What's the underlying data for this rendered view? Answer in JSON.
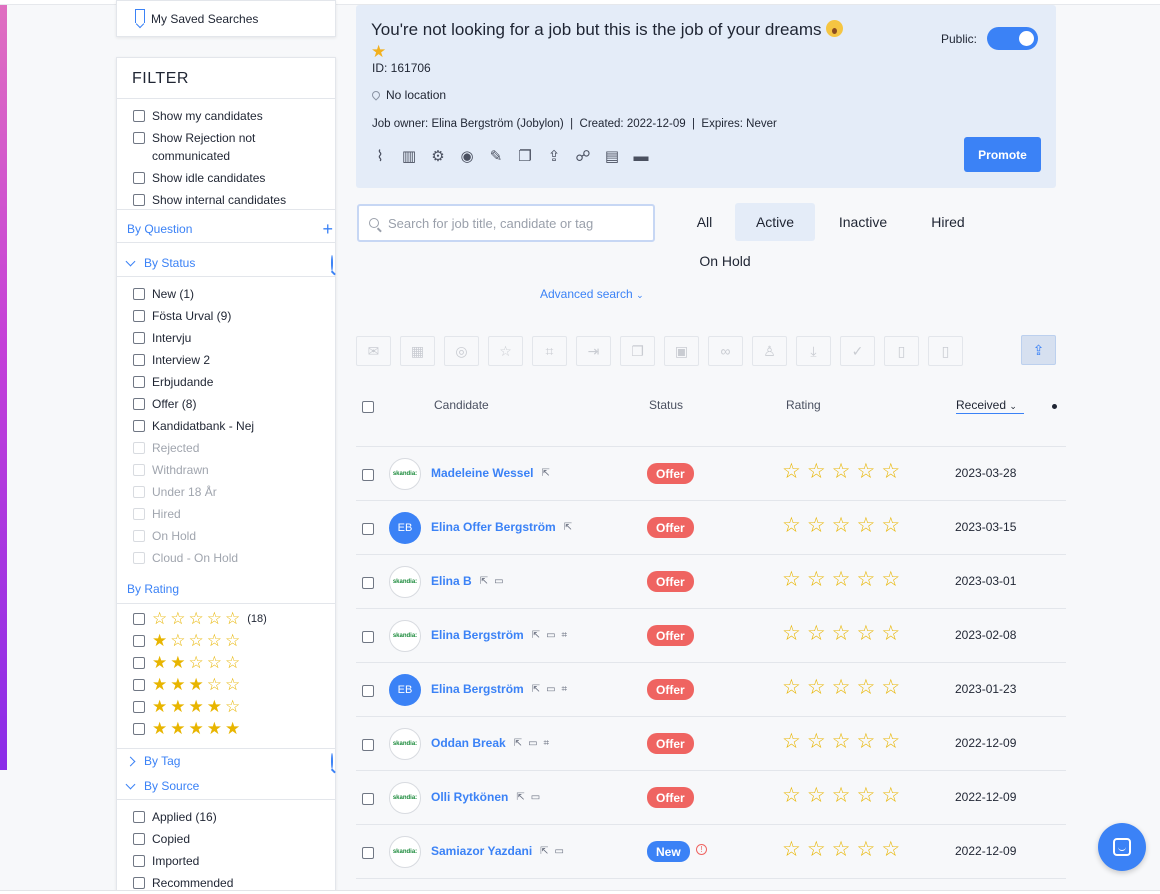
{
  "sidebar": {
    "saved_searches": "My Saved Searches",
    "filter_title": "FILTER",
    "general": [
      {
        "label": "Show my candidates"
      },
      {
        "label": "Show Rejection not communicated"
      },
      {
        "label": "Show idle candidates"
      },
      {
        "label": "Show internal candidates"
      }
    ],
    "by_question": "By Question",
    "by_status": "By Status",
    "statuses": [
      {
        "label": "New (1)",
        "disabled": false
      },
      {
        "label": "Fösta Urval (9)",
        "disabled": false
      },
      {
        "label": "Intervju",
        "disabled": false
      },
      {
        "label": "Interview 2",
        "disabled": false
      },
      {
        "label": "Erbjudande",
        "disabled": false
      },
      {
        "label": "Offer (8)",
        "disabled": false
      },
      {
        "label": "Kandidatbank - Nej",
        "disabled": false
      },
      {
        "label": "Rejected",
        "disabled": true
      },
      {
        "label": "Withdrawn",
        "disabled": true
      },
      {
        "label": "Under 18 År",
        "disabled": true
      },
      {
        "label": "Hired",
        "disabled": true
      },
      {
        "label": "On Hold",
        "disabled": true
      },
      {
        "label": "Cloud - On Hold",
        "disabled": true
      }
    ],
    "by_rating": "By Rating",
    "ratings": [
      {
        "filled": 0,
        "count": "(18)"
      },
      {
        "filled": 1,
        "count": ""
      },
      {
        "filled": 2,
        "count": ""
      },
      {
        "filled": 3,
        "count": ""
      },
      {
        "filled": 4,
        "count": ""
      },
      {
        "filled": 5,
        "count": ""
      }
    ],
    "by_tag": "By Tag",
    "by_source": "By Source",
    "sources": [
      {
        "label": "Applied (16)"
      },
      {
        "label": "Copied"
      },
      {
        "label": "Imported"
      },
      {
        "label": "Recommended"
      }
    ]
  },
  "job": {
    "title": "You're not looking for a job but this is the job of your dreams",
    "id": "ID: 161706",
    "location": "No location",
    "meta": "Job owner: Elina Bergström (Jobylon)  |  Created: 2022-12-09  |  Expires: Never",
    "public_label": "Public:",
    "public_on": true,
    "promote": "Promote",
    "tool_icons": [
      "attachment-icon",
      "stats-icon",
      "settings-icon",
      "preview-icon",
      "edit-icon",
      "copy-icon",
      "share-icon",
      "team-icon",
      "report-icon",
      "archive-icon"
    ]
  },
  "search": {
    "placeholder": "Search for job title, candidate or tag"
  },
  "tabs": [
    {
      "label": "All",
      "active": false
    },
    {
      "label": "Active",
      "active": true
    },
    {
      "label": "Inactive",
      "active": false
    },
    {
      "label": "Hired",
      "active": false
    },
    {
      "label": "On Hold",
      "active": false
    }
  ],
  "advanced_search": "Advanced search",
  "table": {
    "col_candidate": "Candidate",
    "col_status": "Status",
    "col_rating": "Rating",
    "col_received": "Received",
    "rows": [
      {
        "avatar": "skandia",
        "initials": "",
        "name": "Madeleine Wessel",
        "status": "Offer",
        "date": "2023-03-28"
      },
      {
        "avatar": "initials",
        "initials": "EB",
        "name": "Elina Offer Bergström",
        "status": "Offer",
        "date": "2023-03-15"
      },
      {
        "avatar": "skandia",
        "initials": "",
        "name": "Elina B",
        "status": "Offer",
        "date": "2023-03-01"
      },
      {
        "avatar": "skandia",
        "initials": "",
        "name": "Elina Bergström",
        "status": "Offer",
        "date": "2023-02-08"
      },
      {
        "avatar": "initials",
        "initials": "EB",
        "name": "Elina Bergström",
        "status": "Offer",
        "date": "2023-01-23"
      },
      {
        "avatar": "skandia",
        "initials": "",
        "name": "Oddan Break",
        "status": "Offer",
        "date": "2022-12-09"
      },
      {
        "avatar": "skandia",
        "initials": "",
        "name": "Olli Rytkönen",
        "status": "Offer",
        "date": "2022-12-09"
      },
      {
        "avatar": "skandia",
        "initials": "",
        "name": "Samiazor Yazdani",
        "status": "New",
        "date": "2022-12-09"
      }
    ]
  },
  "colors": {
    "accent": "#3b82f6",
    "offer": "#ef6461",
    "star": "#e8b500",
    "job_card": "#e4ecf8"
  }
}
